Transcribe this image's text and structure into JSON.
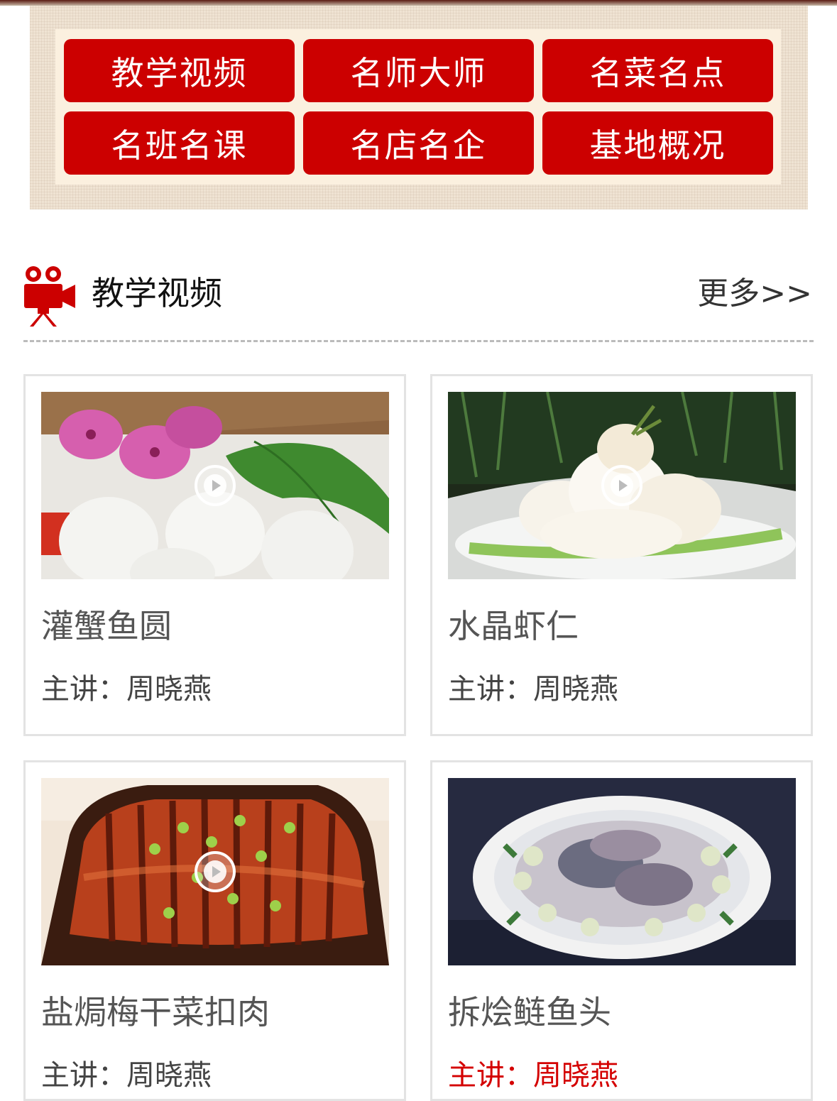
{
  "nav": {
    "buttons": [
      "教学视频",
      "名师大师",
      "名菜名点",
      "名班名课",
      "名店名企",
      "基地概况"
    ]
  },
  "section": {
    "title": "教学视频",
    "more": "更多>>",
    "icon": "movie-camera-icon",
    "accent": "#cc0000"
  },
  "videos": [
    {
      "title": "灌蟹鱼圆",
      "lecturer_label": "主讲：",
      "lecturer": "周晓燕",
      "image": "fish-balls-with-flowers"
    },
    {
      "title": "水晶虾仁",
      "lecturer_label": "主讲：",
      "lecturer": "周晓燕",
      "image": "crystal-shrimp"
    },
    {
      "title": "盐焗梅干菜扣肉",
      "lecturer_label": "主讲：",
      "lecturer": "周晓燕",
      "image": "braised-pork-belly"
    },
    {
      "title": "拆烩鲢鱼头",
      "lecturer_label": "主讲：",
      "lecturer": "周晓燕",
      "image": "fish-head-stew"
    }
  ]
}
